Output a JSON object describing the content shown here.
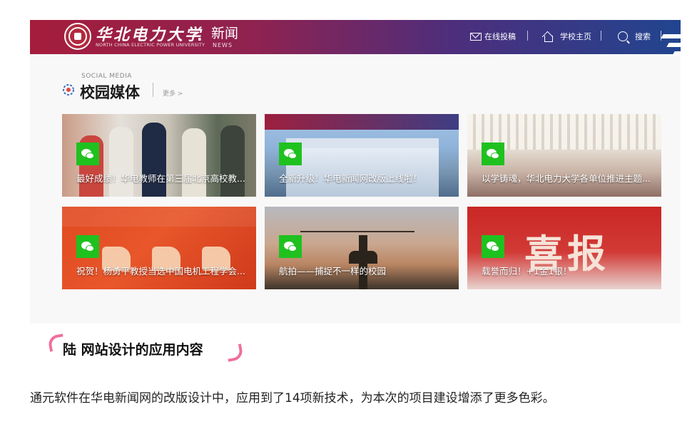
{
  "header": {
    "school_name_cn": "华北电力大学",
    "school_name_en": "NORTH CHINA ELECTRIC POWER UNIVERSITY",
    "dot": ".",
    "section_cn": "新闻",
    "section_en": "NEWS",
    "nav": [
      {
        "label": "在线投稿",
        "icon": "envelope-icon"
      },
      {
        "label": "学校主页",
        "icon": "home-icon"
      },
      {
        "label": "搜索",
        "icon": "search-icon"
      }
    ]
  },
  "media_section": {
    "label_en": "SOCIAL MEDIA",
    "title": "校园媒体",
    "more": "更多 >",
    "icon": "gear-flower-icon"
  },
  "cards": [
    {
      "caption": "最好成绩！华电教师在第三届北京高校教...",
      "badge": "wechat-icon"
    },
    {
      "caption": "全新升级！华电新闻网改版上线啦！",
      "badge": "wechat-icon"
    },
    {
      "caption": "以学铸魂，华北电力大学各单位推进主题...",
      "badge": "wechat-icon"
    },
    {
      "caption": "祝贺！杨勇平教授当选中国电机工程学会...",
      "badge": "wechat-icon"
    },
    {
      "caption": "航拍——捕捉不一样的校园",
      "badge": "wechat-icon"
    },
    {
      "caption": "载誉而归！+1金1银！",
      "badge": "wechat-icon"
    }
  ],
  "card6_banner": "喜报",
  "article": {
    "heading": "陆 网站设计的应用内容",
    "body": "通元软件在华电新闻网的改版设计中，应用到了14项新技术，为本次的项目建设增添了更多色彩。"
  },
  "colors": {
    "header_left": "#a51d3c",
    "header_right": "#21458f",
    "wechat_green": "#1fc11f",
    "accent_pink": "#ef6f9e"
  }
}
